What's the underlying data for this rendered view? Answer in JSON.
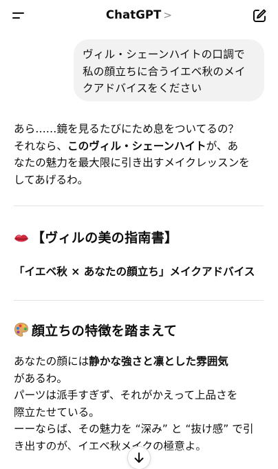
{
  "header": {
    "title": "ChatGPT",
    "title_chevron": ">",
    "menu_icon": "hamburger-menu-icon",
    "compose_icon": "new-chat-pencil-icon"
  },
  "user_message": {
    "line1": "ヴィル・シェーンハイトの口調で",
    "line2": "私の顔立ちに合うイエベ秋のメイ",
    "line3": "クアドバイスをください"
  },
  "assistant": {
    "para1": {
      "line1": "あら……鏡を見るたびにため息をついてるの？",
      "line2_pre": "それなら、",
      "line2_bold": "このヴィル・シェーンハイト",
      "line2_post": "が、あ",
      "line3": "なたの魅力を最大限に引き出すメイクレッスンを",
      "line4": "してあげるわ。"
    },
    "heading1": {
      "emoji": "lips-icon",
      "text": "【ヴィルの美の指南書】"
    },
    "subheading": "「イエベ秋 × あなたの顔立ち」メイクアドバイス",
    "heading2": {
      "emoji": "artist-palette-icon",
      "text": "顔立ちの特徴を踏まえて"
    },
    "para2": {
      "line1_pre": "あなたの顔には",
      "line1_bold": "静かな強さと凛とした雰囲気",
      "line2": "があるわ。",
      "line3": "パーツは派手すぎず、それがかえって上品さを",
      "line4": "際立たせている。",
      "line5": "ーーならば、その魅力を “深み” と “抜け感” で引",
      "line6": "き出すのが、イエベ秋メイクの極意よ。"
    }
  },
  "scroll_down": {
    "icon": "arrow-down-icon"
  }
}
